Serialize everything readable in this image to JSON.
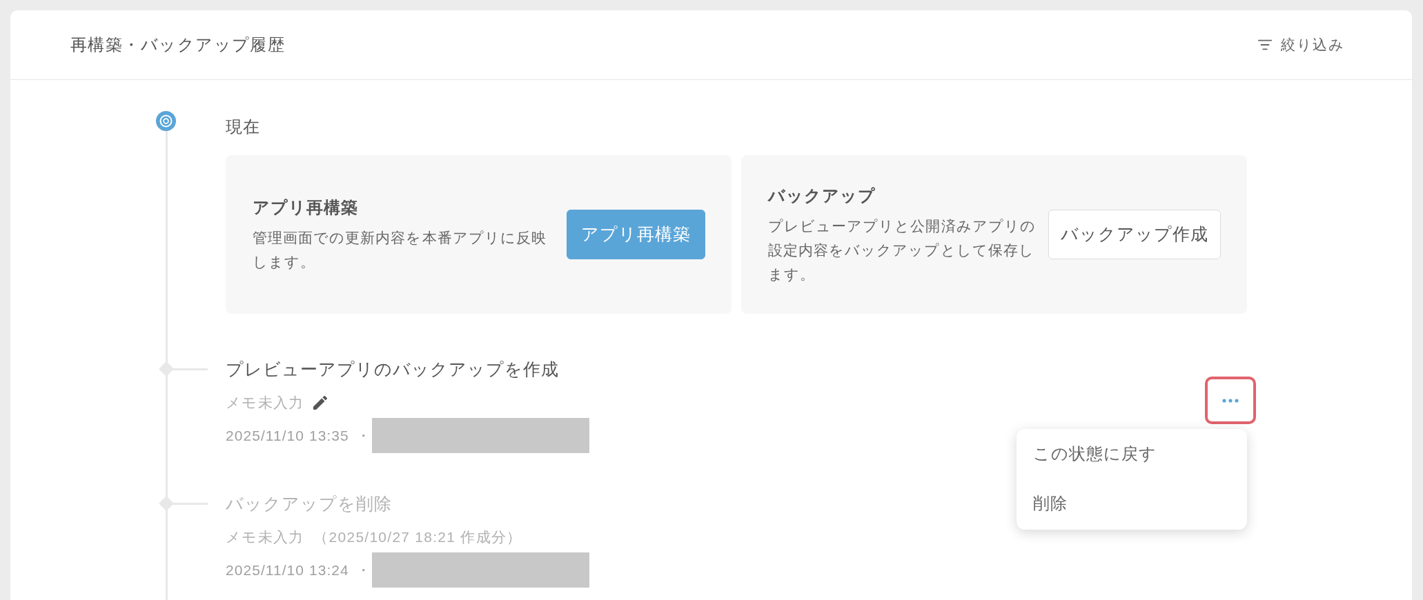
{
  "panel": {
    "title": "再構築・バックアップ履歴",
    "filter": {
      "label": "絞り込み"
    }
  },
  "current": {
    "label": "現在",
    "cards": [
      {
        "title": "アプリ再構築",
        "description": "管理画面での更新内容を本番アプリに反映します。",
        "button": {
          "label": "アプリ再構築",
          "kind": "primary"
        }
      },
      {
        "title": "バックアップ",
        "description": "プレビューアプリと公開済みアプリの設定内容をバックアップとして保存します。",
        "button": {
          "label": "バックアップ作成",
          "kind": "secondary"
        }
      }
    ]
  },
  "history": [
    {
      "title": "プレビューアプリのバックアップを作成",
      "dimmed": false,
      "memo": "メモ未入力",
      "editable": true,
      "timestamp": "2025/11/10 13:35",
      "separator": "・",
      "more_button": {
        "highlighted": true,
        "expanded": true,
        "menu": [
          {
            "label": "この状態に戻す"
          },
          {
            "label": "削除"
          }
        ]
      }
    },
    {
      "title": "バックアップを削除",
      "dimmed": true,
      "memo": "メモ未入力",
      "note": "（2025/10/27 18:21 作成分）",
      "editable": false,
      "timestamp": "2025/11/10 13:24",
      "separator": "・"
    }
  ]
}
